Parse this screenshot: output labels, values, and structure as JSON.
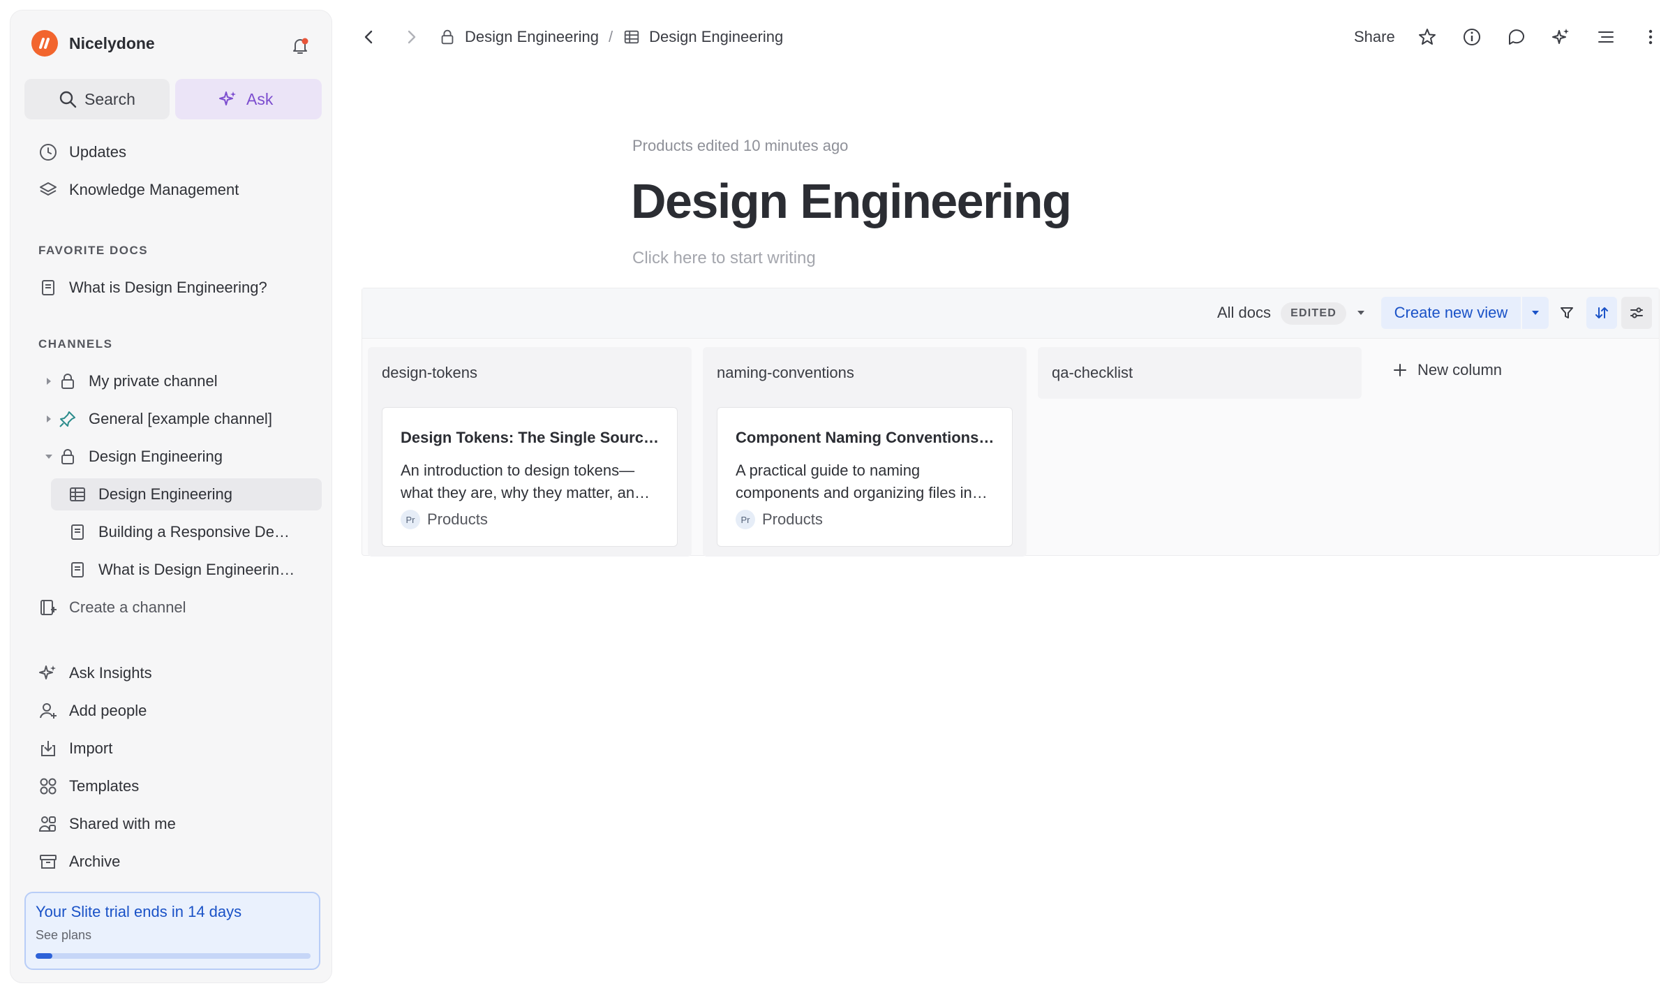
{
  "colors": {
    "brand": "#f2652e",
    "accent_blue": "#1a52c7",
    "ask_purple": "#7c4dcf",
    "notification_dot": "#e8553a"
  },
  "sidebar": {
    "workspace": "Nicelydone",
    "search_label": "Search",
    "ask_label": "Ask",
    "top_items": [
      {
        "label": "Updates",
        "icon": "clock-icon"
      },
      {
        "label": "Knowledge Management",
        "icon": "layers-icon"
      }
    ],
    "favorites_header": "FAVORITE DOCS",
    "favorites": [
      {
        "label": "What is Design Engineering?",
        "icon": "doc-icon"
      }
    ],
    "channels_header": "CHANNELS",
    "channels": [
      {
        "label": "My private channel",
        "icon": "lock-icon",
        "expanded": false
      },
      {
        "label": "General [example channel]",
        "icon": "pin-icon",
        "expanded": false
      },
      {
        "label": "Design Engineering",
        "icon": "lock-icon",
        "expanded": true
      }
    ],
    "channel_children": [
      {
        "label": "Design Engineering",
        "icon": "table-icon",
        "active": true
      },
      {
        "label": "Building a Responsive De…",
        "icon": "doc-icon"
      },
      {
        "label": "What is Design Engineerin…",
        "icon": "doc-icon"
      }
    ],
    "create_channel": "Create a channel",
    "bottom_items": [
      {
        "label": "Ask Insights",
        "icon": "sparkle-icon"
      },
      {
        "label": "Add people",
        "icon": "add-person-icon"
      },
      {
        "label": "Import",
        "icon": "import-icon"
      },
      {
        "label": "Templates",
        "icon": "templates-icon"
      },
      {
        "label": "Shared with me",
        "icon": "shared-icon"
      },
      {
        "label": "Archive",
        "icon": "archive-icon"
      }
    ],
    "trial": {
      "title": "Your Slite trial ends in 14 days",
      "subtitle": "See plans",
      "progress": 0.06
    }
  },
  "topbar": {
    "breadcrumb": [
      {
        "label": "Design Engineering",
        "icon": "lock-icon"
      },
      {
        "label": "Design Engineering",
        "icon": "table-icon"
      }
    ],
    "separator": "/",
    "share_label": "Share"
  },
  "doc": {
    "edited_note": "Products edited 10 minutes ago",
    "title": "Design Engineering",
    "placeholder": "Click here to start writing"
  },
  "board": {
    "view_label": "All docs",
    "view_badge": "EDITED",
    "create_view": "Create new view",
    "columns": [
      {
        "title": "design-tokens",
        "cards": [
          {
            "title": "Design Tokens: The Single Sourc…",
            "desc": "An introduction to design tokens—what they are, why they matter, an…",
            "tag": "Products",
            "tag_abbr": "Pr"
          }
        ]
      },
      {
        "title": "naming-conventions",
        "cards": [
          {
            "title": "Component Naming Conventions…",
            "desc": "A practical guide to naming components and organizing files in…",
            "tag": "Products",
            "tag_abbr": "Pr"
          }
        ]
      },
      {
        "title": "qa-checklist",
        "cards": []
      }
    ],
    "new_column": "New column"
  }
}
